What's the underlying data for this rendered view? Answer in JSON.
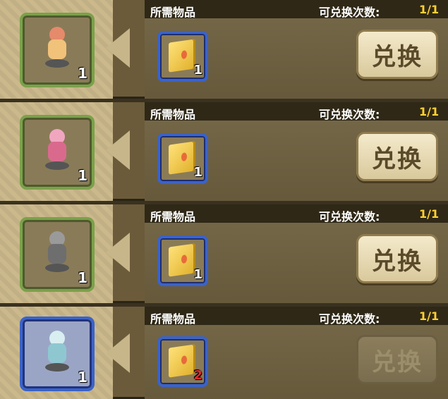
{
  "rows": [
    {
      "header_left": "所需物品",
      "header_right_label": "可兑换次数:",
      "header_right_value": "1/1",
      "reward": {
        "icon": "pink-cat-girl-figure-icon",
        "count": "1",
        "frame": "green"
      },
      "required_item": {
        "icon": "golden-book-icon",
        "count": "1",
        "count_color": "#ffffff"
      },
      "button": {
        "label": "兑换",
        "enabled": true
      }
    },
    {
      "header_left": "所需物品",
      "header_right_label": "可兑换次数:",
      "header_right_value": "1/1",
      "reward": {
        "icon": "pink-bunny-girl-figure-icon",
        "count": "1",
        "frame": "green"
      },
      "required_item": {
        "icon": "golden-book-icon",
        "count": "1",
        "count_color": "#ffffff"
      },
      "button": {
        "label": "兑换",
        "enabled": true
      }
    },
    {
      "header_left": "所需物品",
      "header_right_label": "可兑换次数:",
      "header_right_value": "1/1",
      "reward": {
        "icon": "armored-knight-figure-icon",
        "count": "1",
        "frame": "green"
      },
      "required_item": {
        "icon": "golden-book-icon",
        "count": "1",
        "count_color": "#ffffff"
      },
      "button": {
        "label": "兑换",
        "enabled": true
      }
    },
    {
      "header_left": "所需物品",
      "header_right_label": "可兑换次数:",
      "header_right_value": "1/1",
      "reward": {
        "icon": "teal-hair-girl-figure-icon",
        "count": "1",
        "frame": "blue"
      },
      "required_item": {
        "icon": "golden-book-icon",
        "count": "2",
        "count_color": "#e02a2a"
      },
      "button": {
        "label": "兑换",
        "enabled": false
      }
    }
  ],
  "colors": {
    "header_value": "#ffd232",
    "frame_green": "#7aa14a",
    "frame_blue": "#3b63c9",
    "insufficient_count": "#e02a2a"
  }
}
